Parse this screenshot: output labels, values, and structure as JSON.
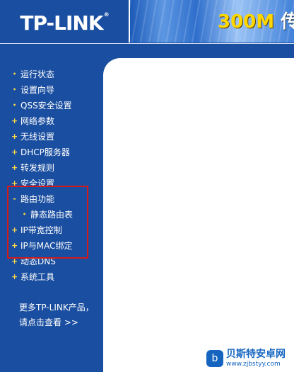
{
  "header": {
    "logo": "TP-LINK",
    "logo_mark": "®",
    "banner_model": "300M",
    "banner_cn": "传"
  },
  "nav": {
    "items": [
      {
        "marker": "•",
        "label": "运行状态"
      },
      {
        "marker": "•",
        "label": "设置向导"
      },
      {
        "marker": "•",
        "label": "QSS安全设置"
      },
      {
        "marker": "+",
        "label": "网络参数"
      },
      {
        "marker": "+",
        "label": "无线设置"
      },
      {
        "marker": "+",
        "label": "DHCP服务器"
      },
      {
        "marker": "+",
        "label": "转发规则"
      },
      {
        "marker": "+",
        "label": "安全设置"
      },
      {
        "marker": "-",
        "label": "路由功能"
      },
      {
        "marker": "•",
        "label": "静态路由表"
      },
      {
        "marker": "+",
        "label": "IP带宽控制"
      },
      {
        "marker": "+",
        "label": "IP与MAC绑定"
      },
      {
        "marker": "+",
        "label": "动态DNS"
      },
      {
        "marker": "+",
        "label": "系统工具"
      }
    ]
  },
  "more": {
    "line1": "更多TP-LINK产品，",
    "line2": "请点击查看 >>"
  },
  "watermark": {
    "title": "贝斯特安卓网",
    "url": "www.zjbstyy.com",
    "icon": "b"
  },
  "colors": {
    "sidebar_bg": "#1a4ea0",
    "highlight": "#d11a1a",
    "marker": "#ffd84a"
  }
}
